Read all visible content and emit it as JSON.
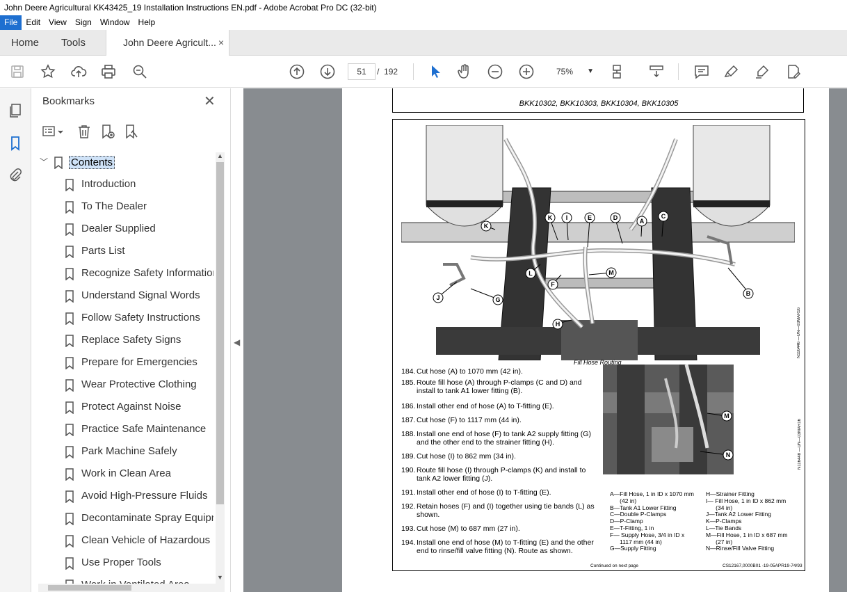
{
  "window": {
    "title": "John Deere Agricultural KK43425_19 Installation Instructions EN.pdf - Adobe Acrobat Pro DC (32-bit)"
  },
  "menu": [
    "File",
    "Edit",
    "View",
    "Sign",
    "Window",
    "Help"
  ],
  "tabs": {
    "home": "Home",
    "tools": "Tools",
    "doc": "John Deere Agricult...",
    "close": "×"
  },
  "toolbar": {
    "page_current": "51",
    "page_sep": "/",
    "page_total": "192",
    "zoom": "75%"
  },
  "bookmarks": {
    "title": "Bookmarks",
    "root": "Contents",
    "items": [
      "Introduction",
      "To The Dealer",
      "Dealer Supplied",
      "Parts List",
      "Recognize Safety Information",
      "Understand Signal Words",
      "Follow Safety Instructions",
      "Replace Safety Signs",
      "Prepare for Emergencies",
      "Wear Protective Clothing",
      "Protect Against Noise",
      "Practice Safe Maintenance",
      "Park Machine Safely",
      "Work in Clean Area",
      "Avoid High-Pressure Fluids",
      "Decontaminate Spray Equipm",
      "Clean Vehicle of Hazardous C",
      "Use Proper Tools",
      "Work in Ventilated Area"
    ]
  },
  "document": {
    "header": "BKK10302, BKK10303, BKK10304, BKK10305",
    "caption": "Fill Hose Routing",
    "figure_id_1": "N116446 —UN—03MAR16",
    "figure_id_2": "N116448 —UN—03MAR16",
    "callouts": [
      "K",
      "K",
      "I",
      "E",
      "D",
      "A",
      "C",
      "L",
      "M",
      "F",
      "J",
      "G",
      "H",
      "B"
    ],
    "callouts2": [
      "M",
      "N"
    ],
    "steps": [
      {
        "n": "184.",
        "t": "Cut hose (A) to 1070 mm (42 in)."
      },
      {
        "n": "185.",
        "t": "Route fill hose (A) through P-clamps (C and D) and install to tank A1 lower fitting (B)."
      },
      {
        "n": "186.",
        "t": "Install other end of hose (A) to T-fitting (E)."
      },
      {
        "n": "187.",
        "t": "Cut hose (F) to 1117 mm (44 in)."
      },
      {
        "n": "188.",
        "t": "Install one end of hose (F) to tank A2 supply fitting (G) and the other end to the strainer fitting (H)."
      },
      {
        "n": "189.",
        "t": "Cut hose (I) to 862 mm (34 in)."
      },
      {
        "n": "190.",
        "t": "Route fill hose (I) through P-clamps (K) and install to tank A2 lower fitting (J)."
      },
      {
        "n": "191.",
        "t": "Install other end of hose (I) to T-fitting (E)."
      },
      {
        "n": "192.",
        "t": "Retain hoses (F) and (I) together using tie bands (L) as shown."
      },
      {
        "n": "193.",
        "t": "Cut hose (M) to 687 mm (27 in)."
      },
      {
        "n": "194.",
        "t": "Install one end of hose (M) to T-fitting (E) and the other end to rinse/fill valve fitting (N). Route as shown."
      }
    ],
    "legend_left": [
      "A—Fill Hose, 1 in ID x 1070 mm",
      "      (42 in)",
      "B—Tank A1 Lower Fitting",
      "C—Double P-Clamps",
      "D—P-Clamp",
      "E—T-Fitting, 1 in",
      "F— Supply Hose, 3/4 in ID x",
      "      1117 mm (44 in)",
      "G—Supply Fitting"
    ],
    "legend_right": [
      "H—Strainer Fitting",
      "I— Fill Hose, 1 in ID x 862 mm",
      "      (34 in)",
      "J—Tank A2 Lower Fitting",
      "K—P-Clamps",
      "L—Tie Bands",
      "M—Fill Hose, 1 in ID x 687 mm",
      "      (27 in)",
      "N—Rinse/Fill Valve Fitting"
    ],
    "continued": "Continued on next page",
    "code": "CS12167,0000B01 -19-05APR19-74/93"
  }
}
